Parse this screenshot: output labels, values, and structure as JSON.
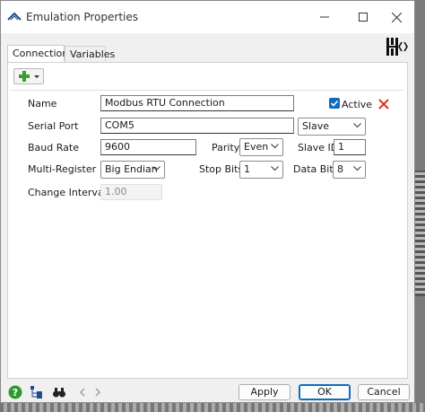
{
  "window": {
    "title": "Emulation Properties"
  },
  "tabs": [
    {
      "label": "Connections"
    },
    {
      "label": "Variables"
    }
  ],
  "form": {
    "name_label": "Name",
    "name_value": "Modbus RTU Connection",
    "active_label": "Active",
    "active_checked": true,
    "serial_port_label": "Serial Port",
    "serial_port_value": "COM5",
    "mode_value": "Slave",
    "baud_rate_label": "Baud Rate",
    "baud_rate_value": "9600",
    "parity_label": "Parity",
    "parity_value": "Even",
    "slave_id_label": "Slave ID",
    "slave_id_value": "1",
    "multi_register_label": "Multi-Register",
    "multi_register_value": "Big Endian",
    "stop_bits_label": "Stop Bits",
    "stop_bits_value": "1",
    "data_bits_label": "Data Bits",
    "data_bits_value": "8",
    "change_interval_label": "Change Interval",
    "change_interval_value": "1.00"
  },
  "buttons": {
    "apply": "Apply",
    "ok": "OK",
    "cancel": "Cancel"
  },
  "colors": {
    "accent": "#0f6cbd",
    "delete": "#d9361e",
    "add": "#3aa02c",
    "help": "#2e9a2e"
  }
}
